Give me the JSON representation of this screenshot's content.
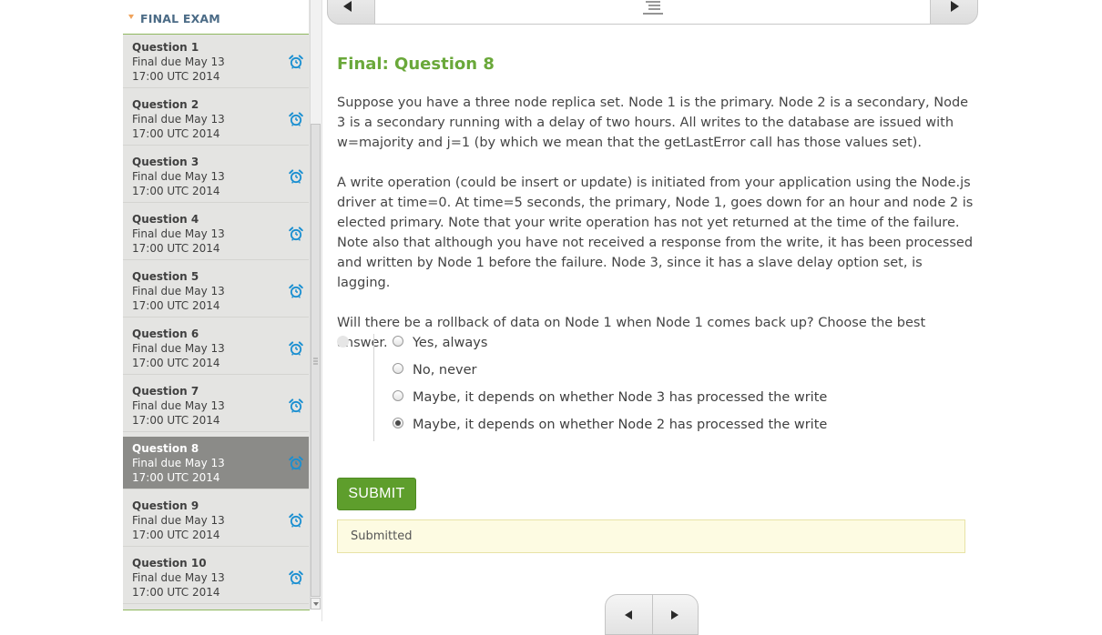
{
  "sidebar": {
    "section_title": "FINAL EXAM",
    "items": [
      {
        "name": "Question 1",
        "due": "Final due May 13 17:00 UTC 2014",
        "active": false
      },
      {
        "name": "Question 2",
        "due": "Final due May 13 17:00 UTC 2014",
        "active": false
      },
      {
        "name": "Question 3",
        "due": "Final due May 13 17:00 UTC 2014",
        "active": false
      },
      {
        "name": "Question 4",
        "due": "Final due May 13 17:00 UTC 2014",
        "active": false
      },
      {
        "name": "Question 5",
        "due": "Final due May 13 17:00 UTC 2014",
        "active": false
      },
      {
        "name": "Question 6",
        "due": "Final due May 13 17:00 UTC 2014",
        "active": false
      },
      {
        "name": "Question 7",
        "due": "Final due May 13 17:00 UTC 2014",
        "active": false
      },
      {
        "name": "Question 8",
        "due": "Final due May 13 17:00 UTC 2014",
        "active": true
      },
      {
        "name": "Question 9",
        "due": "Final due May 13 17:00 UTC 2014",
        "active": false
      },
      {
        "name": "Question 10",
        "due": "Final due May 13 17:00 UTC 2014",
        "active": false
      }
    ],
    "item_icon": "alarm-clock-icon"
  },
  "nav": {
    "prev_icon": "triangle-left-icon",
    "next_icon": "triangle-right-icon",
    "center_icon": "list-icon"
  },
  "question": {
    "title": "Final: Question 8",
    "paragraph_1": "Suppose you have a three node replica set. Node 1 is the primary. Node 2 is a secondary, Node 3 is a secondary running with a delay of two hours. All writes to the database are issued with w=majority and j=1 (by which we mean that the getLastError call has those values set).",
    "paragraph_2": "A write operation (could be insert or update) is initiated from your application using the Node.js driver at time=0. At time=5 seconds, the primary, Node 1, goes down for an hour and node 2 is elected primary. Note that your write operation has not yet returned at the time of the failure. Note also that although you have not received a response from the write, it has been processed and written by Node 1 before the failure. Node 3, since it has a slave delay option set, is lagging.",
    "prompt": "Will there be a rollback of data on Node 1 when Node 1 comes back up? Choose the best answer.",
    "choices": [
      {
        "label": "Yes, always",
        "selected": false
      },
      {
        "label": "No, never",
        "selected": false
      },
      {
        "label": "Maybe, it depends on whether Node 3 has processed the write",
        "selected": false
      },
      {
        "label": "Maybe, it depends on whether Node 2 has processed the write",
        "selected": true
      }
    ],
    "submit_label": "SUBMIT",
    "status_message": "Submitted"
  },
  "colors": {
    "accent_green": "#6aa83a",
    "submit_green": "#5e9e2c",
    "alarm_blue": "#1a8fd1",
    "active_item": "#8b8b88",
    "sidebar_bg": "#e4e4e2",
    "notice_bg": "#fdfbe2"
  }
}
